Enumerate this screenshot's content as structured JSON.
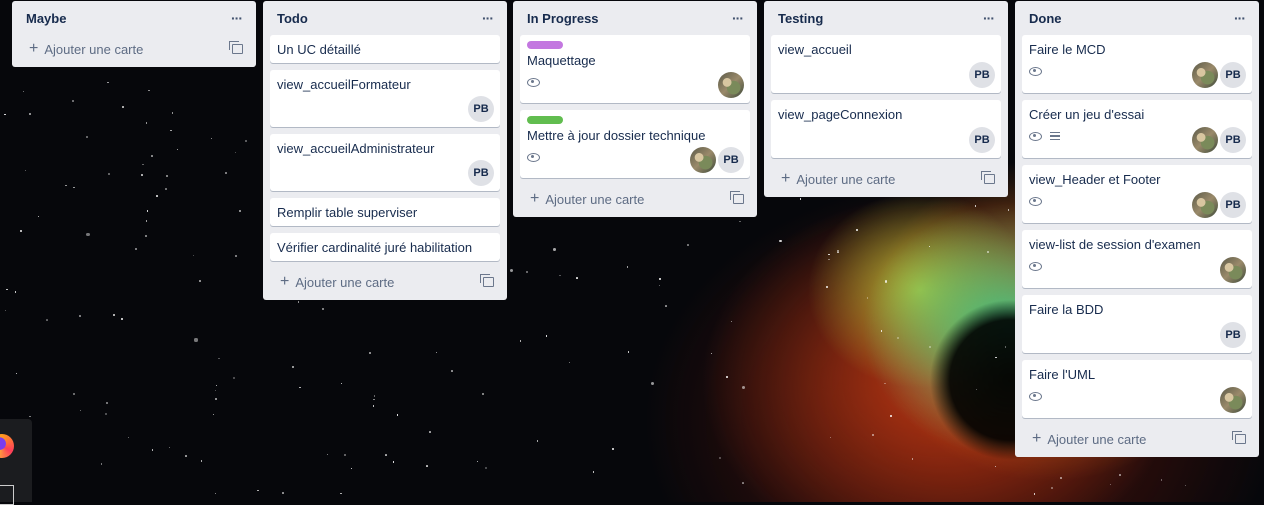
{
  "board": {
    "add_card_label": "Ajouter une carte",
    "lists": [
      {
        "title": "Maybe",
        "cards": []
      },
      {
        "title": "Todo",
        "cards": [
          {
            "title": "Un UC détaillé"
          },
          {
            "title": "view_accueilFormateur",
            "members": [
              "PB"
            ]
          },
          {
            "title": "view_accueilAdministrateur",
            "members": [
              "PB"
            ]
          },
          {
            "title": "Remplir table superviser"
          },
          {
            "title": "Vérifier cardinalité juré habilitation"
          }
        ]
      },
      {
        "title": "In Progress",
        "cards": [
          {
            "title": "Maquettage",
            "label_color": "#c377e0",
            "watched": true,
            "members": [
              "photo"
            ]
          },
          {
            "title": "Mettre à jour dossier technique",
            "label_color": "#61bd4f",
            "watched": true,
            "members": [
              "photo",
              "PB"
            ]
          }
        ]
      },
      {
        "title": "Testing",
        "cards": [
          {
            "title": "view_accueil",
            "members": [
              "PB"
            ]
          },
          {
            "title": "view_pageConnexion",
            "members": [
              "PB"
            ]
          }
        ]
      },
      {
        "title": "Done",
        "cards": [
          {
            "title": "Faire le MCD",
            "watched": true,
            "members": [
              "photo",
              "PB"
            ]
          },
          {
            "title": "Créer un jeu d'essai",
            "watched": true,
            "description": true,
            "members": [
              "photo",
              "PB"
            ]
          },
          {
            "title": "view_Header et Footer",
            "watched": true,
            "members": [
              "photo",
              "PB"
            ]
          },
          {
            "title": "view-list de session d'examen",
            "watched": true,
            "members": [
              "photo"
            ]
          },
          {
            "title": "Faire la BDD",
            "members": [
              "PB"
            ]
          },
          {
            "title": "Faire l'UML",
            "watched": true,
            "members": [
              "photo"
            ]
          }
        ]
      }
    ]
  },
  "icons": {
    "list_menu": "dots-icon",
    "add": "plus-icon",
    "template": "card-template-icon",
    "watch": "eye-icon",
    "description": "description-icon"
  }
}
